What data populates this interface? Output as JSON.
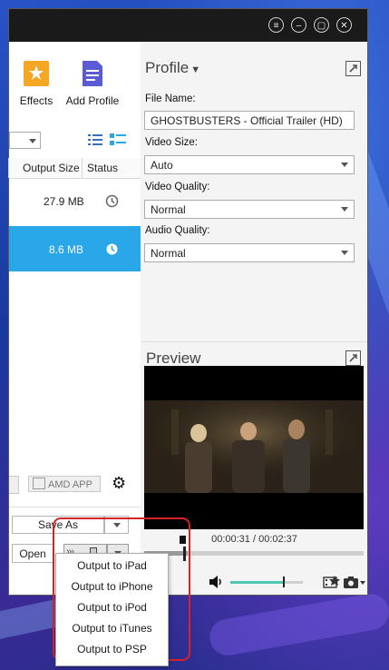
{
  "colors": {
    "accent": "#29a7e8",
    "titlebar": "#1a1a1a",
    "highlight": "#d6232a",
    "slider": "#4cc6b3"
  },
  "toolbar": {
    "effects_label": "Effects",
    "add_profile_label": "Add Profile"
  },
  "file_list": {
    "columns": [
      "Output Size",
      "Status"
    ],
    "rows": [
      {
        "size": "27.9 MB",
        "selected": false
      },
      {
        "size": "8.6 MB",
        "selected": true
      }
    ],
    "amd_label": "AMD APP"
  },
  "actions": {
    "save_as_label": "Save As",
    "open_label": "Open"
  },
  "profile": {
    "title": "Profile",
    "file_name_label": "File Name:",
    "file_name_value": "GHOSTBUSTERS - Official Trailer (HD)",
    "video_size_label": "Video Size:",
    "video_size_value": "Auto",
    "video_quality_label": "Video Quality:",
    "video_quality_value": "Normal",
    "audio_quality_label": "Audio Quality:",
    "audio_quality_value": "Normal"
  },
  "preview": {
    "title": "Preview",
    "time": "00:00:31 / 00:02:37",
    "volume": 0.72,
    "progress": 0.2
  },
  "output_menu": {
    "items": [
      "Output to iPad",
      "Output to iPhone",
      "Output to iPod",
      "Output to iTunes",
      "Output to PSP"
    ]
  }
}
